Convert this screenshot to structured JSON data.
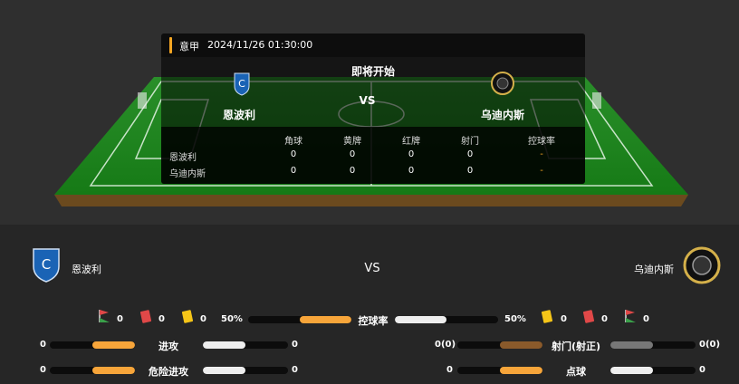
{
  "match": {
    "league": "意甲",
    "datetime": "2024/11/26 01:30:00",
    "status": "即将开始",
    "vs": "VS"
  },
  "home": {
    "name": "恩波利",
    "logo_icon": "empoli-crest-icon"
  },
  "away": {
    "name": "乌迪内斯",
    "logo_icon": "udinese-crest-icon"
  },
  "summary_table": {
    "headers": [
      "角球",
      "黄牌",
      "红牌",
      "射门",
      "控球率"
    ],
    "rows": [
      {
        "team": "恩波利",
        "values": [
          "0",
          "0",
          "0",
          "0",
          "-"
        ]
      },
      {
        "team": "乌迪内斯",
        "values": [
          "0",
          "0",
          "0",
          "0",
          "-"
        ]
      }
    ]
  },
  "counters": {
    "home": {
      "corners": "0",
      "red": "0",
      "yellow": "0"
    },
    "away": {
      "yellow": "0",
      "red": "0",
      "corners": "0"
    }
  },
  "stats": [
    {
      "label": "控球率",
      "home": "50%",
      "away": "50%",
      "home_fraction": 0.5,
      "away_fraction": 0.5
    },
    {
      "label": "进攻",
      "home": "0",
      "away": "0",
      "home_fraction": 0.5,
      "away_fraction": 0.5
    },
    {
      "label": "危险进攻",
      "home": "0",
      "away": "0",
      "home_fraction": 0.5,
      "away_fraction": 0.5
    },
    {
      "label": "射门(射正)",
      "home": "0(0)",
      "away": "0(0)",
      "home_fraction": 0.5,
      "away_fraction": 0.5
    },
    {
      "label": "点球",
      "home": "0",
      "away": "0",
      "home_fraction": 0.5,
      "away_fraction": 0.5
    }
  ],
  "colors": {
    "accent": "#f5a623",
    "home_bar": "#f7a53a",
    "away_bar": "#eeeeee",
    "pitch_green": "#1f8a1f"
  }
}
